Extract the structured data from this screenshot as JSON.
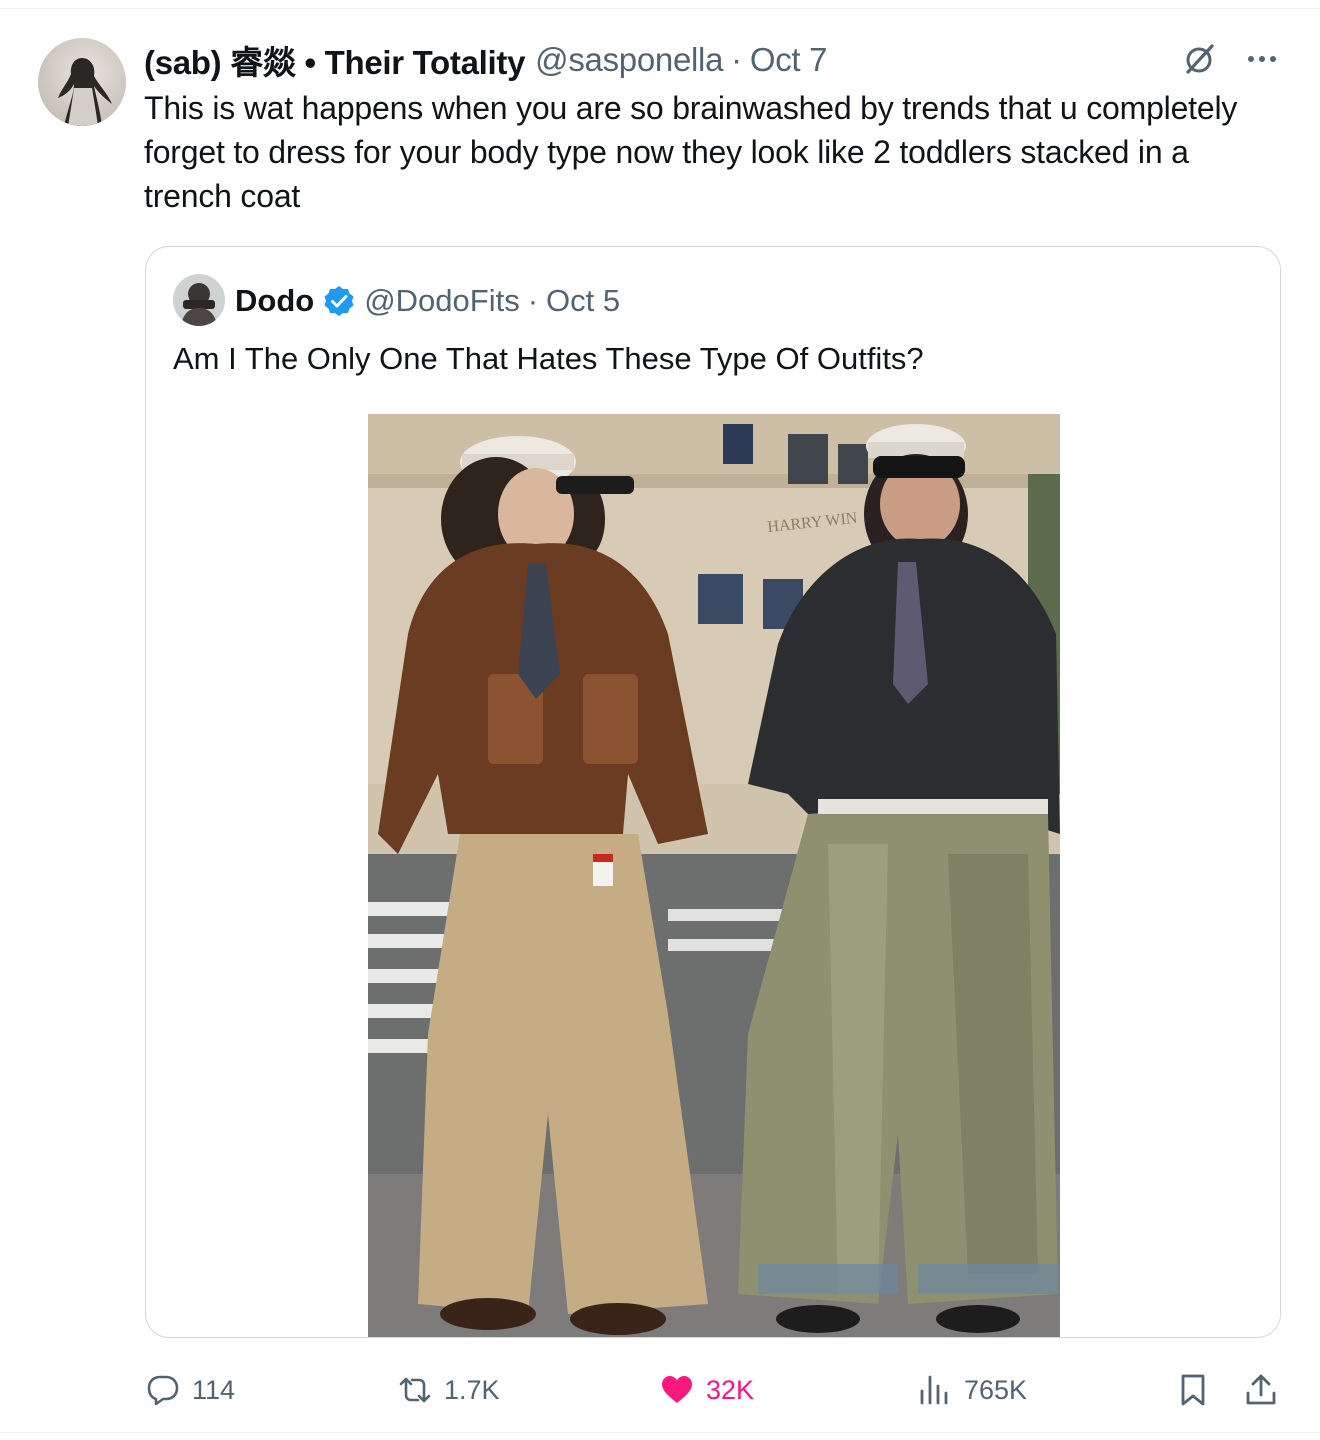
{
  "tweet": {
    "author": {
      "display_name": "(sab) 睿燚 • Their Totality",
      "handle": "@sasponella",
      "date": "Oct 7",
      "separator": "·"
    },
    "text": "This is wat happens when you are so brainwashed by trends that u completely forget to dress for your body type now they look like 2 toddlers stacked in a trench coat",
    "quoted": {
      "display_name": "Dodo",
      "handle": "@DodoFits",
      "separator": "·",
      "date": "Oct 5",
      "text": "Am I The Only One That Hates These Type Of Outfits?",
      "verified": true,
      "image_visible_text": [
        "HARRY WIN",
        "Marlboro"
      ]
    },
    "metrics": {
      "replies": "114",
      "reposts": "1.7K",
      "likes": "32K",
      "views": "765K"
    }
  },
  "icons": {
    "header": [
      "grok-icon",
      "more-icon"
    ],
    "actions": [
      "reply-icon",
      "repost-icon",
      "like-icon",
      "views-icon",
      "bookmark-icon",
      "share-icon"
    ]
  },
  "colors": {
    "text": "#0f1419",
    "secondary": "#536471",
    "like": "#f91880",
    "verified": "#1d9bf0",
    "border": "#cfd9de"
  }
}
